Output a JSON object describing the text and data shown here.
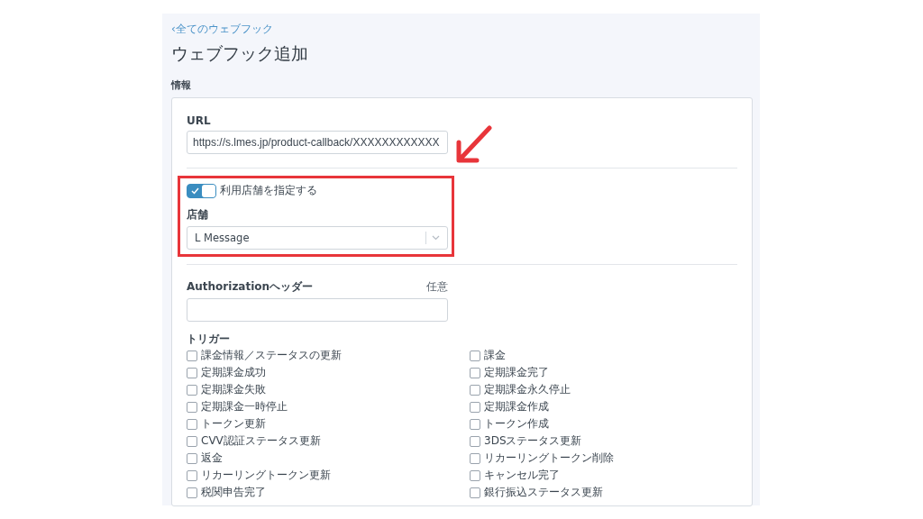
{
  "back_link": "‹全てのウェブフック",
  "title": "ウェブフック追加",
  "section_label": "情報",
  "url": {
    "label": "URL",
    "value": "https://s.lmes.jp/product-callback/XXXXXXXXXXXX"
  },
  "store_toggle": {
    "label": "利用店舗を指定する",
    "on": true
  },
  "store": {
    "label": "店舗",
    "value": "L Message"
  },
  "authorization": {
    "label": "Authorizationヘッダー",
    "note": "任意"
  },
  "trigger": {
    "label": "トリガー",
    "columns": [
      [
        {
          "label": "課金情報／ステータスの更新",
          "checked": false
        },
        {
          "label": "定期課金成功",
          "checked": false
        },
        {
          "label": "定期課金失敗",
          "checked": false
        },
        {
          "label": "定期課金一時停止",
          "checked": false
        },
        {
          "label": "トークン更新",
          "checked": false
        },
        {
          "label": "CVV認証ステータス更新",
          "checked": false
        },
        {
          "label": "返金",
          "checked": false
        },
        {
          "label": "リカーリングトークン更新",
          "checked": false
        },
        {
          "label": "税関申告完了",
          "checked": false
        }
      ],
      [
        {
          "label": "課金",
          "checked": false
        },
        {
          "label": "定期課金完了",
          "checked": false
        },
        {
          "label": "定期課金永久停止",
          "checked": false
        },
        {
          "label": "定期課金作成",
          "checked": false
        },
        {
          "label": "トークン作成",
          "checked": false
        },
        {
          "label": "3DSステータス更新",
          "checked": false
        },
        {
          "label": "リカーリングトークン削除",
          "checked": false
        },
        {
          "label": "キャンセル完了",
          "checked": false
        },
        {
          "label": "銀行振込ステータス更新",
          "checked": false
        }
      ]
    ]
  }
}
